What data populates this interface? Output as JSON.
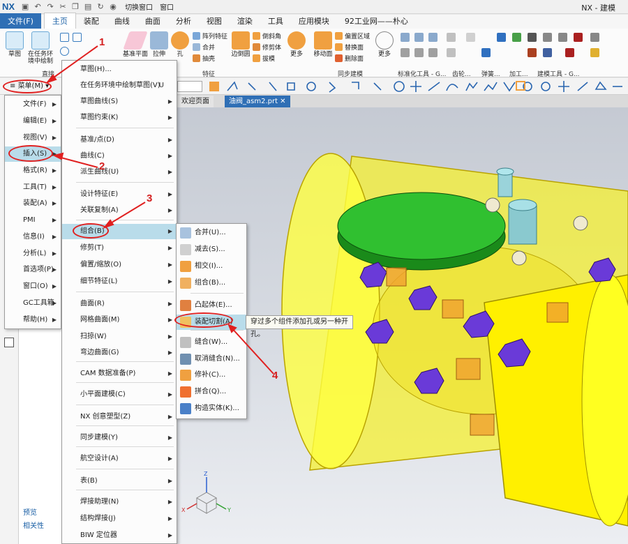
{
  "title_bar": {
    "logo": "NX",
    "switch_window": "切换窗口",
    "window_menu": "窗口",
    "app_title": "NX - 建模"
  },
  "ribbon_tabs": [
    "文件(F)",
    "主页",
    "装配",
    "曲线",
    "曲面",
    "分析",
    "视图",
    "渲染",
    "工具",
    "应用模块",
    "92工业网——朴心"
  ],
  "ribbon": {
    "buttons": {
      "sketch": "草图",
      "task_sketch_1": "在任务环",
      "task_sketch_2": "境中绘制",
      "datum_plane": "基准平面",
      "extrude": "拉伸",
      "hole": "孔",
      "edge_blend": "边倒圆",
      "more1": "更多",
      "move_face": "移动面",
      "more2": "更多"
    },
    "small": {
      "pattern_feature": "阵列特征",
      "unite": "合并",
      "shell": "抽壳",
      "chamfer": "倒斜角",
      "trim_body": "修剪体",
      "draft": "拔模",
      "offset_region": "偏置区域",
      "replace_face": "替换面",
      "delete_face": "删除面"
    },
    "groups": {
      "direct_sketch": "直接",
      "feature": "特征",
      "sync_modeling": "同步建模",
      "standard_parts": "标准化工具 - G...",
      "gear": "齿轮...",
      "spring": "弹簧...",
      "machining": "加工...",
      "modeling_tools": "建模工具 - G..."
    }
  },
  "command_bar": {
    "menu_button": "菜单(M)"
  },
  "doc_tabs": {
    "welcome": "欢迎页面",
    "active_file": "油阀_asm2.prt"
  },
  "nav_panel": {
    "preview": "预览",
    "dependencies": "相关性"
  },
  "main_menu": {
    "items": [
      {
        "label": "文件(F)",
        "submenu": true
      },
      {
        "label": "编辑(E)",
        "submenu": true
      },
      {
        "label": "视图(V)",
        "submenu": true
      },
      {
        "label": "插入(S)",
        "submenu": true,
        "highlighted": true
      },
      {
        "label": "格式(R)",
        "submenu": true
      },
      {
        "label": "工具(T)",
        "submenu": true
      },
      {
        "label": "装配(A)",
        "submenu": true
      },
      {
        "label": "PMI",
        "submenu": true
      },
      {
        "label": "信息(I)",
        "submenu": true
      },
      {
        "label": "分析(L)",
        "submenu": true
      },
      {
        "label": "首选项(P)",
        "submenu": true
      },
      {
        "label": "窗口(O)",
        "submenu": true
      },
      {
        "label": "GC工具箱",
        "submenu": true
      },
      {
        "label": "帮助(H)",
        "submenu": true
      }
    ]
  },
  "insert_menu": {
    "items": [
      {
        "label": "草图(H)...",
        "submenu": false
      },
      {
        "label": "在任务环境中绘制草图(V)",
        "shortcut": "U",
        "submenu": false
      },
      {
        "label": "草图曲线(S)",
        "submenu": true
      },
      {
        "label": "草图约束(K)",
        "submenu": true
      },
      {
        "label": "基准/点(D)",
        "submenu": true
      },
      {
        "label": "曲线(C)",
        "submenu": true
      },
      {
        "label": "派生曲线(U)",
        "submenu": true
      },
      {
        "label": "设计特征(E)",
        "submenu": true
      },
      {
        "label": "关联复制(A)",
        "submenu": true
      },
      {
        "label": "组合(B)",
        "submenu": true,
        "highlighted": true
      },
      {
        "label": "修剪(T)",
        "submenu": true
      },
      {
        "label": "偏置/缩放(O)",
        "submenu": true
      },
      {
        "label": "细节特征(L)",
        "submenu": true
      },
      {
        "label": "曲面(R)",
        "submenu": true
      },
      {
        "label": "网格曲面(M)",
        "submenu": true
      },
      {
        "label": "扫掠(W)",
        "submenu": true
      },
      {
        "label": "弯边曲面(G)",
        "submenu": true
      },
      {
        "label": "CAM 数据准备(P)",
        "submenu": true
      },
      {
        "label": "小平面建模(C)",
        "submenu": true
      },
      {
        "label": "NX 创意塑型(Z)",
        "submenu": true
      },
      {
        "label": "同步建模(Y)",
        "submenu": true
      },
      {
        "label": "航空设计(A)",
        "submenu": true
      },
      {
        "label": "表(B)",
        "submenu": true
      },
      {
        "label": "焊接助理(N)",
        "submenu": true
      },
      {
        "label": "结构焊接(J)",
        "submenu": true
      },
      {
        "label": "BIW 定位器",
        "submenu": true
      }
    ]
  },
  "combine_menu": {
    "items": [
      {
        "label": "合并(U)...",
        "icon": "unite-icon"
      },
      {
        "label": "减去(S)...",
        "icon": "subtract-icon"
      },
      {
        "label": "相交(I)...",
        "icon": "intersect-icon"
      },
      {
        "label": "组合(B)...",
        "icon": "combine-icon"
      },
      {
        "label": "凸起体(E)...",
        "icon": "emboss-body-icon"
      },
      {
        "label": "装配切割(A)",
        "icon": "assembly-cut-icon",
        "highlighted": true
      },
      {
        "label": "缝合(W)...",
        "icon": "sew-icon"
      },
      {
        "label": "取消缝合(N)...",
        "icon": "unsew-icon"
      },
      {
        "label": "修补(C)...",
        "icon": "patch-icon"
      },
      {
        "label": "拼合(Q)...",
        "icon": "merge-icon"
      },
      {
        "label": "构造实体(K)...",
        "icon": "construct-solid-icon"
      }
    ]
  },
  "tooltip": "穿过多个组件添加孔或另一种开孔。",
  "annotations": [
    "1",
    "2",
    "3",
    "4"
  ],
  "colors": {
    "accent": "#2f6fb5",
    "highlight": "#b9dcea",
    "annotation": "#e02020",
    "model_yellow": "#ffff00",
    "flange_green": "#22b022",
    "bolt_purple": "#6a3ad8"
  }
}
